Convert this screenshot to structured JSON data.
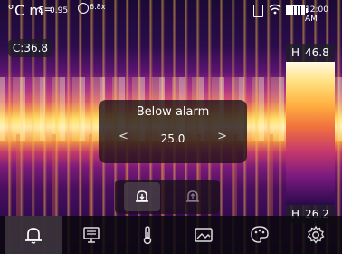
{
  "status_bar": {
    "unit": "°C m",
    "emissivity": "0.95",
    "zoom": "6.8x",
    "time": "12:00 AM"
  },
  "center_readout": "C:36.8",
  "scale": {
    "high_tag": "H",
    "high_value": "46.8",
    "low_tag": "H",
    "low_value": "26.2"
  },
  "alarm": {
    "title": "Below alarm",
    "value": "25.0",
    "prev": "<",
    "next": ">"
  },
  "alarm_types": [
    "below-alarm",
    "above-alarm"
  ],
  "toolbar": {
    "items": [
      "alarm-icon",
      "display-icon",
      "thermometer-icon",
      "image-icon",
      "palette-icon",
      "settings-icon"
    ],
    "active_index": 0
  }
}
